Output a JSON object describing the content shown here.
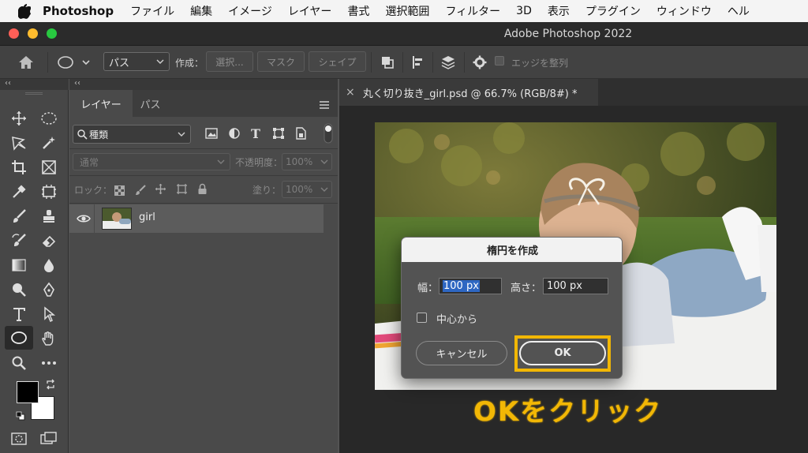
{
  "menubar": {
    "app_name": "Photoshop",
    "items": [
      "ファイル",
      "編集",
      "イメージ",
      "レイヤー",
      "書式",
      "選択範囲",
      "フィルター",
      "3D",
      "表示",
      "プラグイン",
      "ウィンドウ",
      "ヘル"
    ]
  },
  "window": {
    "title": "Adobe Photoshop 2022"
  },
  "options_bar": {
    "mode_value": "パス",
    "make_label": "作成：",
    "selection_button": "選択...",
    "mask_button": "マスク",
    "shape_button": "シェイプ",
    "align_edges_label": "エッジを整列"
  },
  "layers_panel": {
    "tabs": [
      "レイヤー",
      "パス"
    ],
    "filter_value": "種類",
    "blend_mode": "通常",
    "opacity_label": "不透明度：",
    "opacity_value": "100%",
    "lock_label": "ロック：",
    "fill_label": "塗り：",
    "fill_value": "100%",
    "layers": [
      {
        "name": "girl",
        "visible": true
      }
    ]
  },
  "document": {
    "tab_title": "丸く切り抜き_girl.psd @ 66.7% (RGB/8#) *",
    "close_glyph": "×"
  },
  "dialog": {
    "title": "楕円を作成",
    "width_label": "幅：",
    "width_value": "100 px",
    "height_label": "高さ：",
    "height_value": "100 px",
    "center_checkbox_label": "中心から",
    "center_checked": false,
    "cancel_label": "キャンセル",
    "ok_label": "OK"
  },
  "annotation": {
    "text": "OKをクリック",
    "highlight_color": "#f2b705"
  },
  "colors": {
    "foreground": "#000000",
    "background": "#ffffff",
    "selection_highlight": "#2e67c2"
  },
  "toolbar_icons": [
    "move-icon",
    "ellipse-marquee-icon",
    "lasso-icon",
    "magic-wand-icon",
    "crop-icon",
    "frame-icon",
    "eyedropper-icon",
    "ruler-icon",
    "brush-icon",
    "stamp-icon",
    "history-brush-icon",
    "eraser-icon",
    "gradient-icon",
    "blur-icon",
    "dodge-icon",
    "pen-icon",
    "type-icon",
    "path-select-icon",
    "ellipse-tool-icon",
    "hand-icon",
    "zoom-icon",
    "more-tools-icon"
  ]
}
